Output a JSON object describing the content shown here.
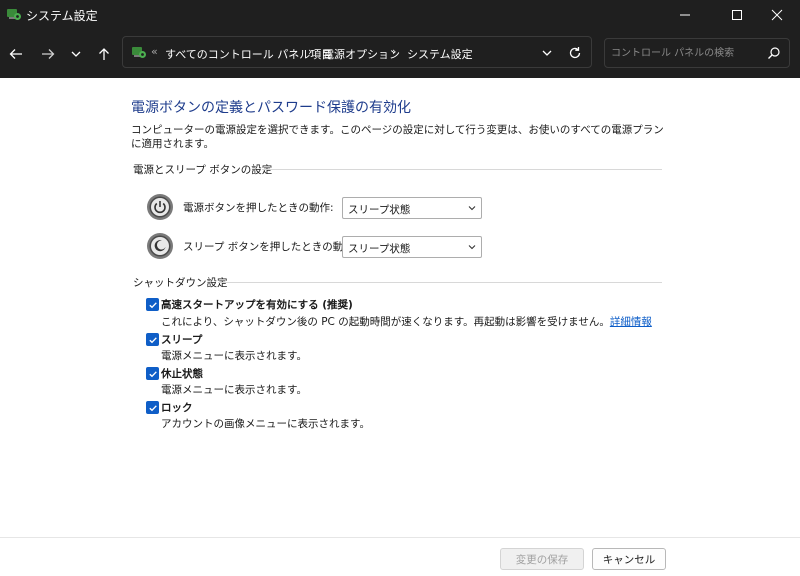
{
  "window": {
    "title": "システム設定"
  },
  "nav": {
    "breadcrumbs": [
      "すべてのコントロール パネル項目",
      "電源オプション",
      "システム設定"
    ],
    "overflow_glyph": "«",
    "separator": "›",
    "search_placeholder": "コントロール パネルの検索"
  },
  "content": {
    "title": "電源ボタンの定義とパスワード保護の有効化",
    "description": "コンピューターの電源設定を選択できます。このページの設定に対して行う変更は、お使いのすべての電源プランに適用されます。",
    "power_section": {
      "heading": "電源とスリープ ボタンの設定",
      "rows": [
        {
          "label": "電源ボタンを押したときの動作:",
          "value": "スリープ状態"
        },
        {
          "label": "スリープ ボタンを押したときの動作:",
          "value": "スリープ状態"
        }
      ]
    },
    "shutdown_section": {
      "heading": "シャットダウン設定",
      "options": [
        {
          "label": "高速スタートアップを有効にする (推奨)",
          "checked": true,
          "description": "これにより、シャットダウン後の PC の起動時間が速くなります。再起動は影響を受けません。",
          "link": "詳細情報"
        },
        {
          "label": "スリープ",
          "checked": true,
          "description": "電源メニューに表示されます。"
        },
        {
          "label": "休止状態",
          "checked": true,
          "description": "電源メニューに表示されます。"
        },
        {
          "label": "ロック",
          "checked": true,
          "description": "アカウントの画像メニューに表示されます。"
        }
      ]
    }
  },
  "footer": {
    "save_label": "変更の保存",
    "cancel_label": "キャンセル"
  },
  "colors": {
    "titlebar_bg": "#1f1f1f",
    "title_blue": "#1e3c8c",
    "checkbox_blue": "#0f5ec7",
    "link_blue": "#0b5cc8"
  }
}
